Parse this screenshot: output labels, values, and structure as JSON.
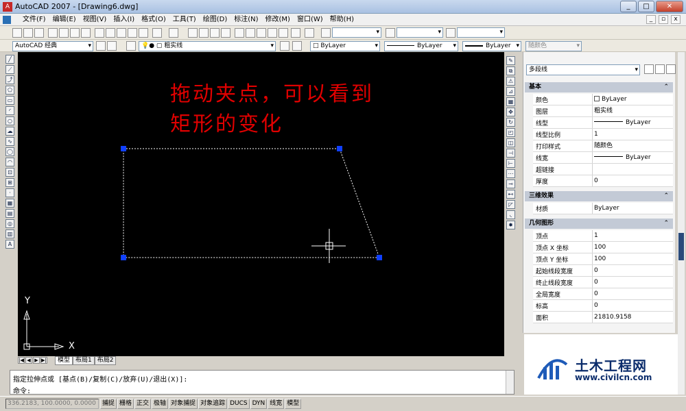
{
  "window": {
    "title": "AutoCAD 2007 - [Drawing6.dwg]",
    "min": "_",
    "max": "□",
    "close": "✕"
  },
  "menu": [
    "文件(F)",
    "编辑(E)",
    "视图(V)",
    "插入(I)",
    "格式(O)",
    "工具(T)",
    "绘图(D)",
    "标注(N)",
    "修改(M)",
    "窗口(W)",
    "帮助(H)"
  ],
  "mdi": {
    "min": "_",
    "restore": "▫",
    "close": "x"
  },
  "toolbar": {
    "workspace": "AutoCAD 经典",
    "layer": "粗实线",
    "color": "□ ByLayer",
    "linetype": "ByLayer",
    "lineweight": "ByLayer",
    "plotstyle": "随颜色"
  },
  "canvas": {
    "note_line1": "拖动夹点，可以看到",
    "note_line2": "矩形的变化",
    "ucs_y": "Y",
    "ucs_x": "X",
    "colors": {
      "background": "#000000",
      "note": "#e00000",
      "grip": "#1040ff",
      "dashed": "#ffffff"
    }
  },
  "tabs": [
    "模型",
    "布局1",
    "布局2"
  ],
  "tab_nav": [
    "|◀",
    "◀",
    "▶",
    "▶|"
  ],
  "command": {
    "line1": "指定拉伸点或 [基点(B)/复制(C)/放弃(U)/退出(X)]:",
    "line2": "命令:"
  },
  "status": {
    "coords": "336.2183, 100.0000, 0.0000",
    "toggles": [
      "捕捉",
      "栅格",
      "正交",
      "极轴",
      "对象捕捉",
      "对象追踪",
      "DUCS",
      "DYN",
      "线宽",
      "模型"
    ]
  },
  "properties": {
    "selection": "多段线",
    "sections": [
      {
        "name": "基本",
        "rows": [
          {
            "k": "颜色",
            "v": "ByLayer",
            "type": "swatch"
          },
          {
            "k": "图层",
            "v": "粗实线"
          },
          {
            "k": "线型",
            "v": "ByLayer",
            "type": "line"
          },
          {
            "k": "线型比例",
            "v": "1"
          },
          {
            "k": "打印样式",
            "v": "随颜色"
          },
          {
            "k": "线宽",
            "v": "ByLayer",
            "type": "line"
          },
          {
            "k": "超链接",
            "v": ""
          },
          {
            "k": "厚度",
            "v": "0"
          }
        ]
      },
      {
        "name": "三维效果",
        "rows": [
          {
            "k": "材质",
            "v": "ByLayer"
          }
        ]
      },
      {
        "name": "几何图形",
        "rows": [
          {
            "k": "顶点",
            "v": "1"
          },
          {
            "k": "顶点 X 坐标",
            "v": "100"
          },
          {
            "k": "顶点 Y 坐标",
            "v": "100"
          },
          {
            "k": "起始线段宽度",
            "v": "0"
          },
          {
            "k": "终止线段宽度",
            "v": "0"
          },
          {
            "k": "全局宽度",
            "v": "0"
          },
          {
            "k": "标高",
            "v": "0"
          },
          {
            "k": "面积",
            "v": "21810.9158"
          }
        ]
      }
    ]
  },
  "left_tools": [
    "line-icon",
    "construction-line-icon",
    "polyline-icon",
    "polygon-icon",
    "rectangle-icon",
    "arc-icon",
    "circle-icon",
    "revision-cloud-icon",
    "spline-icon",
    "ellipse-icon",
    "ellipse-arc-icon",
    "insert-block-icon",
    "make-block-icon",
    "point-icon",
    "hatch-icon",
    "gradient-icon",
    "region-icon",
    "table-icon",
    "mtext-icon"
  ],
  "right_tools": [
    "erase-icon",
    "copy-icon",
    "mirror-icon",
    "offset-icon",
    "array-icon",
    "move-icon",
    "rotate-icon",
    "scale-icon",
    "stretch-icon",
    "trim-icon",
    "extend-icon",
    "break-point-icon",
    "break-icon",
    "join-icon",
    "chamfer-icon",
    "fillet-icon",
    "explode-icon"
  ],
  "logo": {
    "cn": "土木工程网",
    "url": "www.civilcn.com"
  }
}
